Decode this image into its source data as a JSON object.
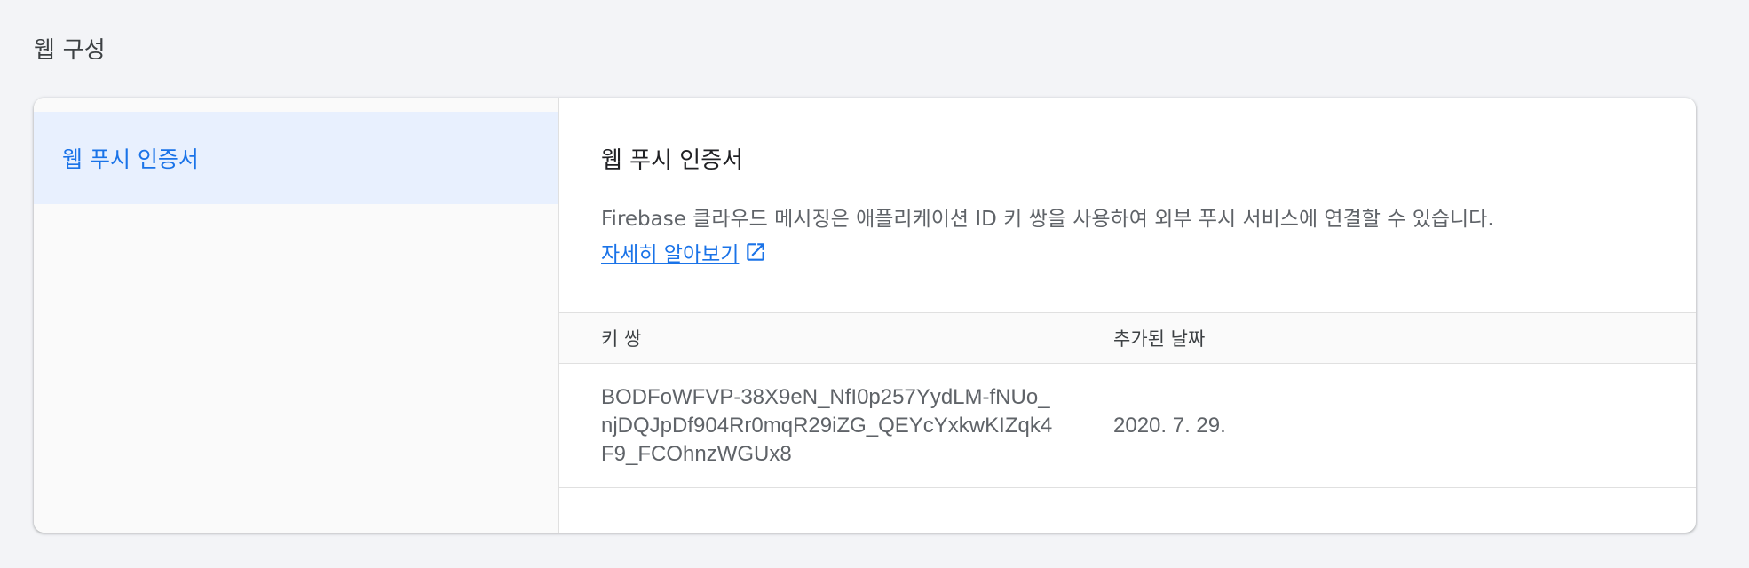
{
  "page": {
    "section_title": "웹 구성"
  },
  "sidebar": {
    "items": [
      {
        "label": "웹 푸시 인증서",
        "active": true
      }
    ]
  },
  "content": {
    "title": "웹 푸시 인증서",
    "description": "Firebase 클라우드 메시징은 애플리케이션 ID 키 쌍을 사용하여 외부 푸시 서비스에 연결할 수 있습니다.",
    "learn_more_label": "자세히 알아보기",
    "learn_more_icon": "open-in-new-icon"
  },
  "table": {
    "headers": {
      "key_pair": "키 쌍",
      "date_added": "추가된 날짜"
    },
    "rows": [
      {
        "key_pair": "BODFoWFVP-38X9eN_NfI0p257YydLM-fNUo_njDQJpDf904Rr0mqR29iZG_QEYcYxkwKIZqk4F9_FCOhnzWGUx8",
        "date_added": "2020. 7. 29."
      }
    ]
  },
  "colors": {
    "accent": "#1a73e8",
    "active_bg": "#e8f0fe",
    "page_bg": "#f3f4f7"
  }
}
